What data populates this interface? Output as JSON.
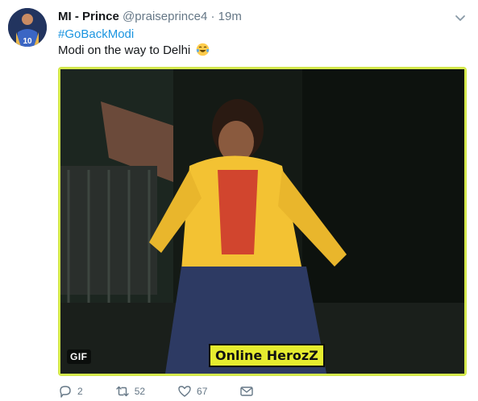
{
  "tweet": {
    "display_name": "MI - Prince",
    "handle": "@praiseprince4",
    "separator": "·",
    "time": "19m",
    "hashtag": "#GoBackModi",
    "text": "Modi on the way to Delhi",
    "avatar_number": "10",
    "media": {
      "badge": "GIF",
      "watermark": "Online HerozZ"
    }
  },
  "actions": {
    "replies": "2",
    "retweets": "52",
    "likes": "67"
  },
  "colors": {
    "link": "#1b95e0",
    "secondary": "#657786",
    "media_border": "#d4e84c"
  },
  "icons": {
    "reply": "reply-icon",
    "retweet": "retweet-icon",
    "like": "heart-icon",
    "dm": "envelope-icon",
    "menu": "chevron-down-icon"
  }
}
